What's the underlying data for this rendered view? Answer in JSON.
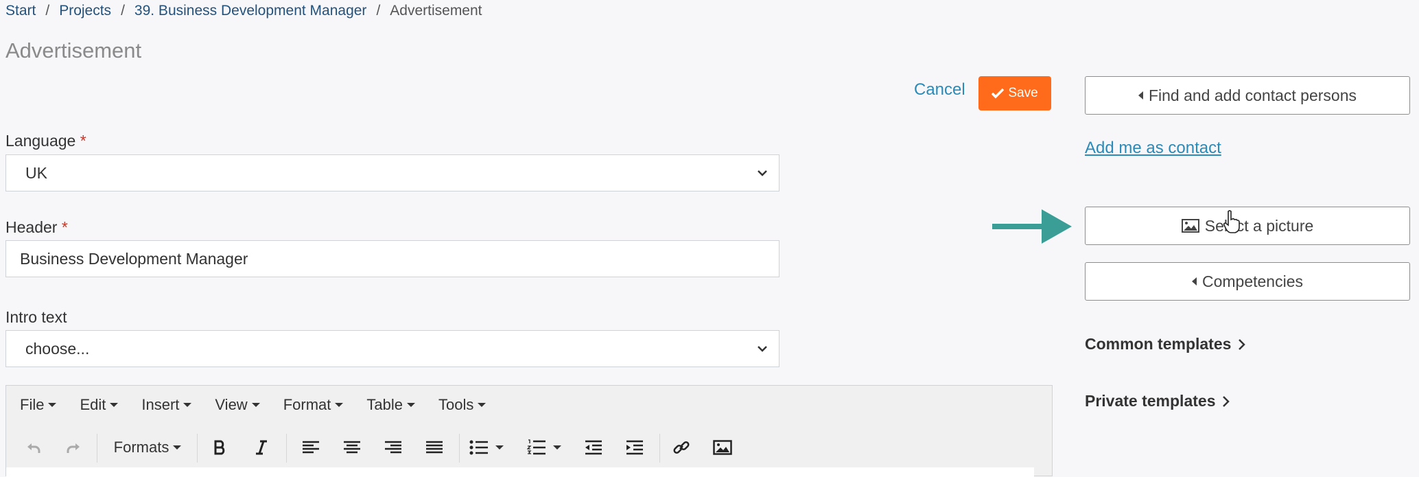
{
  "breadcrumb": {
    "items": [
      "Start",
      "Projects",
      "39. Business Development Manager"
    ],
    "current": "Advertisement",
    "separator": "/"
  },
  "page": {
    "title": "Advertisement"
  },
  "actions": {
    "cancel_label": "Cancel",
    "save_label": "Save"
  },
  "form": {
    "language": {
      "label": "Language",
      "required_mark": "*",
      "value": "UK"
    },
    "header": {
      "label": "Header",
      "required_mark": "*",
      "value": "Business Development Manager"
    },
    "intro": {
      "label": "Intro text",
      "value": "choose..."
    }
  },
  "editor": {
    "menus": [
      "File",
      "Edit",
      "Insert",
      "View",
      "Format",
      "Table",
      "Tools"
    ],
    "formats_label": "Formats"
  },
  "sidebar": {
    "find_contacts_label": "Find and add contact persons",
    "add_me_label": "Add me as contact",
    "select_picture_label": "Select a picture",
    "competencies_label": "Competencies",
    "common_templates_label": "Common templates",
    "private_templates_label": "Private templates"
  },
  "colors": {
    "save_button": "#ff6b1a",
    "link": "#2a8ab8",
    "arrow": "#3a9e96",
    "required": "#c0392b"
  },
  "icons": [
    "checkmark-icon",
    "chevron-down-icon",
    "undo-icon",
    "redo-icon",
    "bold-icon",
    "italic-icon",
    "align-left-icon",
    "align-center-icon",
    "align-right-icon",
    "justify-icon",
    "bullet-list-icon",
    "numbered-list-icon",
    "outdent-icon",
    "indent-icon",
    "link-icon",
    "image-icon",
    "caret-left-icon",
    "chevron-right-icon",
    "mouse-cursor-icon",
    "pointer-arrow-icon"
  ]
}
